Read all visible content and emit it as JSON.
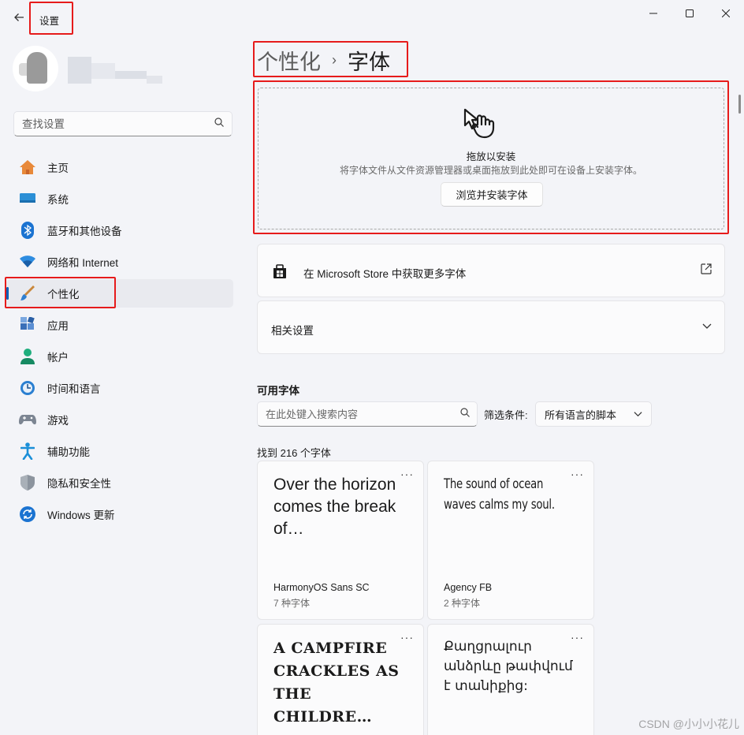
{
  "app": {
    "title": "设置"
  },
  "window_controls": {
    "minimize": "—",
    "maximize": "☐",
    "close": "✕"
  },
  "search": {
    "placeholder": "查找设置"
  },
  "sidebar": {
    "items": [
      {
        "label": "主页",
        "icon": "home-icon"
      },
      {
        "label": "系统",
        "icon": "system-icon"
      },
      {
        "label": "蓝牙和其他设备",
        "icon": "bluetooth-icon"
      },
      {
        "label": "网络和 Internet",
        "icon": "wifi-icon"
      },
      {
        "label": "个性化",
        "icon": "brush-icon",
        "active": true
      },
      {
        "label": "应用",
        "icon": "apps-icon"
      },
      {
        "label": "帐户",
        "icon": "account-icon"
      },
      {
        "label": "时间和语言",
        "icon": "time-language-icon"
      },
      {
        "label": "游戏",
        "icon": "gamepad-icon"
      },
      {
        "label": "辅助功能",
        "icon": "accessibility-icon"
      },
      {
        "label": "隐私和安全性",
        "icon": "shield-icon"
      },
      {
        "label": "Windows 更新",
        "icon": "update-icon"
      }
    ]
  },
  "breadcrumb": {
    "parent": "个性化",
    "separator": "›",
    "current": "字体"
  },
  "dropzone": {
    "title": "拖放以安装",
    "subtitle": "将字体文件从文件资源管理器或桌面拖放到此处即可在设备上安装字体。",
    "button": "浏览并安装字体"
  },
  "store_card": {
    "label": "在 Microsoft Store 中获取更多字体",
    "icon": "external-link-icon"
  },
  "related_card": {
    "label": "相关设置",
    "icon": "chevron-down-icon"
  },
  "fonts_section": {
    "title": "可用字体",
    "search_placeholder": "在此处键入搜索内容",
    "filter_label": "筛选条件:",
    "filter_value": "所有语言的脚本",
    "found": "找到 216 个字体"
  },
  "font_cards": [
    {
      "sample": "Over the horizon comes the break of…",
      "name": "HarmonyOS Sans SC",
      "count": "7 种字体"
    },
    {
      "sample": "The sound of ocean waves calms my soul.",
      "name": "Agency FB",
      "count": "2 种字体"
    },
    {
      "sample": "A CAMPFIRE CRACKLES AS THE CHILDRE…",
      "name": "",
      "count": ""
    },
    {
      "sample": "Քաղցրալուր անձրևը թափվում է տանիքից:",
      "name": "",
      "count": ""
    }
  ],
  "more_glyph": "···",
  "watermark": "CSDN @小小小花儿",
  "colors": {
    "accent": "#005fb8",
    "highlight_box": "#e61b1b",
    "background": "#f3f4f8"
  }
}
